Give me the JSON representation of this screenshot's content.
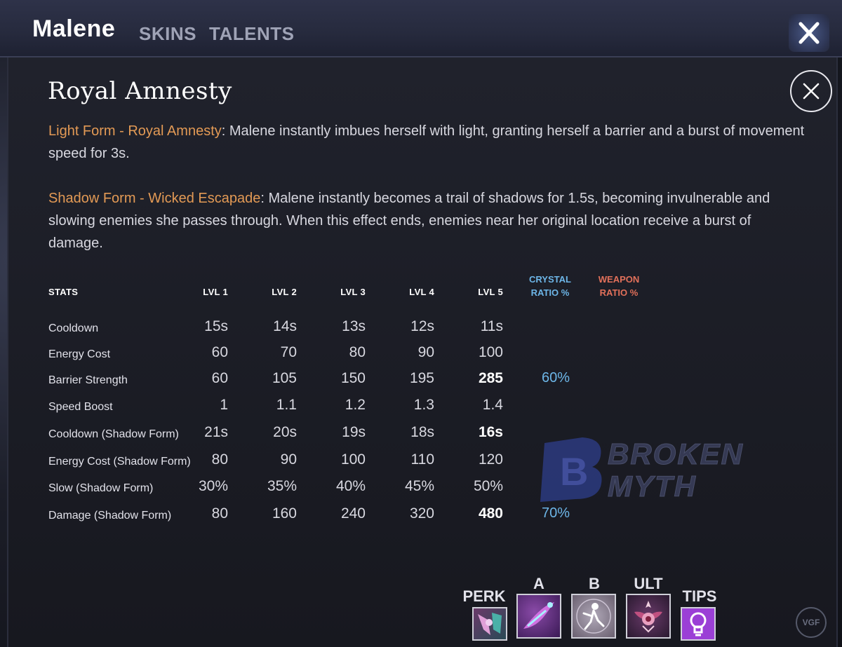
{
  "header": {
    "hero_name": "Malene",
    "tabs": [
      {
        "label": "SKINS"
      },
      {
        "label": "TALENTS"
      }
    ],
    "close_icon": "close-x-icon"
  },
  "ability": {
    "title": "Royal Amnesty",
    "paragraphs": [
      {
        "form_name": "Light Form - Royal Amnesty",
        "text": ": Malene instantly imbues herself with light, granting herself a barrier and a burst of movement speed for 3s."
      },
      {
        "form_name": "Shadow Form - Wicked Escapade",
        "text": ": Malene instantly becomes a trail of shadows for 1.5s, becoming invulnerable and slowing enemies she passes through. When this effect ends, enemies near her original location receive a burst of damage."
      }
    ]
  },
  "stats_table": {
    "headers": {
      "stats": "STATS",
      "levels": [
        "LVL 1",
        "LVL 2",
        "LVL 3",
        "LVL 4",
        "LVL 5"
      ],
      "crystal_line1": "CRYSTAL",
      "crystal_line2": "RATIO %",
      "weapon_line1": "WEAPON",
      "weapon_line2": "RATIO %"
    },
    "rows": [
      {
        "label": "Cooldown",
        "values": [
          "15s",
          "14s",
          "13s",
          "12s",
          "11s"
        ],
        "lvl5_bold": false,
        "crystal": ""
      },
      {
        "label": "Energy Cost",
        "values": [
          "60",
          "70",
          "80",
          "90",
          "100"
        ],
        "lvl5_bold": false,
        "crystal": ""
      },
      {
        "label": "Barrier Strength",
        "values": [
          "60",
          "105",
          "150",
          "195",
          "285"
        ],
        "lvl5_bold": true,
        "crystal": "60%"
      },
      {
        "label": "Speed Boost",
        "values": [
          "1",
          "1.1",
          "1.2",
          "1.3",
          "1.4"
        ],
        "lvl5_bold": false,
        "crystal": ""
      },
      {
        "label": "Cooldown (Shadow Form)",
        "values": [
          "21s",
          "20s",
          "19s",
          "18s",
          "16s"
        ],
        "lvl5_bold": true,
        "crystal": ""
      },
      {
        "label": "Energy Cost (Shadow Form)",
        "values": [
          "80",
          "90",
          "100",
          "110",
          "120"
        ],
        "lvl5_bold": false,
        "crystal": ""
      },
      {
        "label": "Slow (Shadow Form)",
        "values": [
          "30%",
          "35%",
          "40%",
          "45%",
          "50%"
        ],
        "lvl5_bold": false,
        "crystal": ""
      },
      {
        "label": "Damage (Shadow Form)",
        "values": [
          "80",
          "160",
          "240",
          "320",
          "480"
        ],
        "lvl5_bold": true,
        "crystal": "70%"
      }
    ]
  },
  "watermark": {
    "line1": "BROKEN",
    "line2": "MYTH",
    "letter": "B"
  },
  "nav": [
    {
      "label": "PERK",
      "icon": "perk-icon"
    },
    {
      "label": "A",
      "icon": "ability-a-icon"
    },
    {
      "label": "B",
      "icon": "ability-b-icon"
    },
    {
      "label": "ULT",
      "icon": "ultimate-icon"
    },
    {
      "label": "TIPS",
      "icon": "lightbulb-icon"
    }
  ],
  "corner_logo": "VGF",
  "colors": {
    "form_name": "#e39a55",
    "crystal": "#6db6e8",
    "weapon": "#e2705a",
    "tips_bg": "#9b3fd6"
  }
}
